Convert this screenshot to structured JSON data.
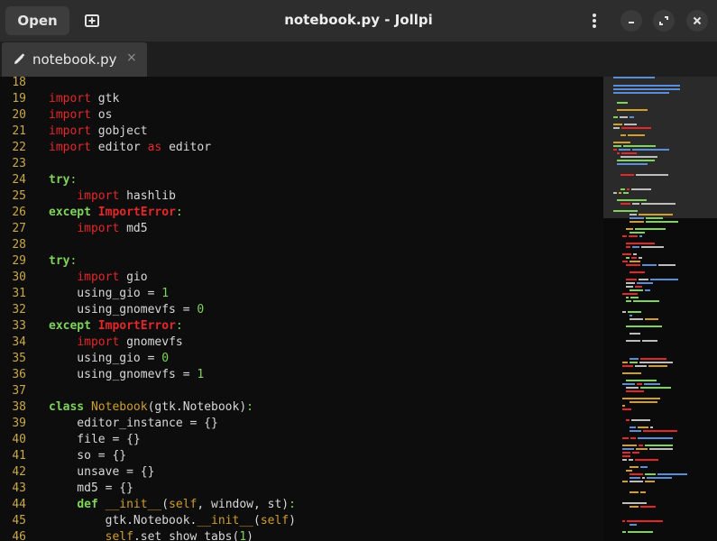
{
  "header": {
    "open_label": "Open",
    "title": "notebook.py - Jollpi"
  },
  "tabs": [
    {
      "label": "notebook.py",
      "close": "×"
    }
  ],
  "colors": {
    "keyword": "#e5272a",
    "control": "#7ed35a",
    "classname": "#cf9f2a",
    "line_number": "#c8a848",
    "text": "#d8d8d8"
  },
  "code_lines": [
    {
      "n": "18",
      "t": ""
    },
    {
      "n": "19",
      "t": "import gtk"
    },
    {
      "n": "20",
      "t": "import os"
    },
    {
      "n": "21",
      "t": "import gobject"
    },
    {
      "n": "22",
      "t": "import editor as editor"
    },
    {
      "n": "23",
      "t": ""
    },
    {
      "n": "24",
      "t": "try:"
    },
    {
      "n": "25",
      "t": "    import hashlib"
    },
    {
      "n": "26",
      "t": "except ImportError:"
    },
    {
      "n": "27",
      "t": "    import md5"
    },
    {
      "n": "28",
      "t": ""
    },
    {
      "n": "29",
      "t": "try:"
    },
    {
      "n": "30",
      "t": "    import gio"
    },
    {
      "n": "31",
      "t": "    using_gio = 1"
    },
    {
      "n": "32",
      "t": "    using_gnomevfs = 0"
    },
    {
      "n": "33",
      "t": "except ImportError:"
    },
    {
      "n": "34",
      "t": "    import gnomevfs"
    },
    {
      "n": "35",
      "t": "    using_gio = 0"
    },
    {
      "n": "36",
      "t": "    using_gnomevfs = 1"
    },
    {
      "n": "37",
      "t": ""
    },
    {
      "n": "38",
      "t": "class Notebook(gtk.Notebook):"
    },
    {
      "n": "39",
      "t": "    editor_instance = {}"
    },
    {
      "n": "40",
      "t": "    file = {}"
    },
    {
      "n": "41",
      "t": "    so = {}"
    },
    {
      "n": "42",
      "t": "    unsave = {}"
    },
    {
      "n": "43",
      "t": "    md5 = {}"
    },
    {
      "n": "44",
      "t": "    def __init__(self, window, st):"
    },
    {
      "n": "45",
      "t": "        gtk.Notebook.__init__(self)"
    },
    {
      "n": "46",
      "t": "        self.set_show_tabs(1)"
    }
  ]
}
